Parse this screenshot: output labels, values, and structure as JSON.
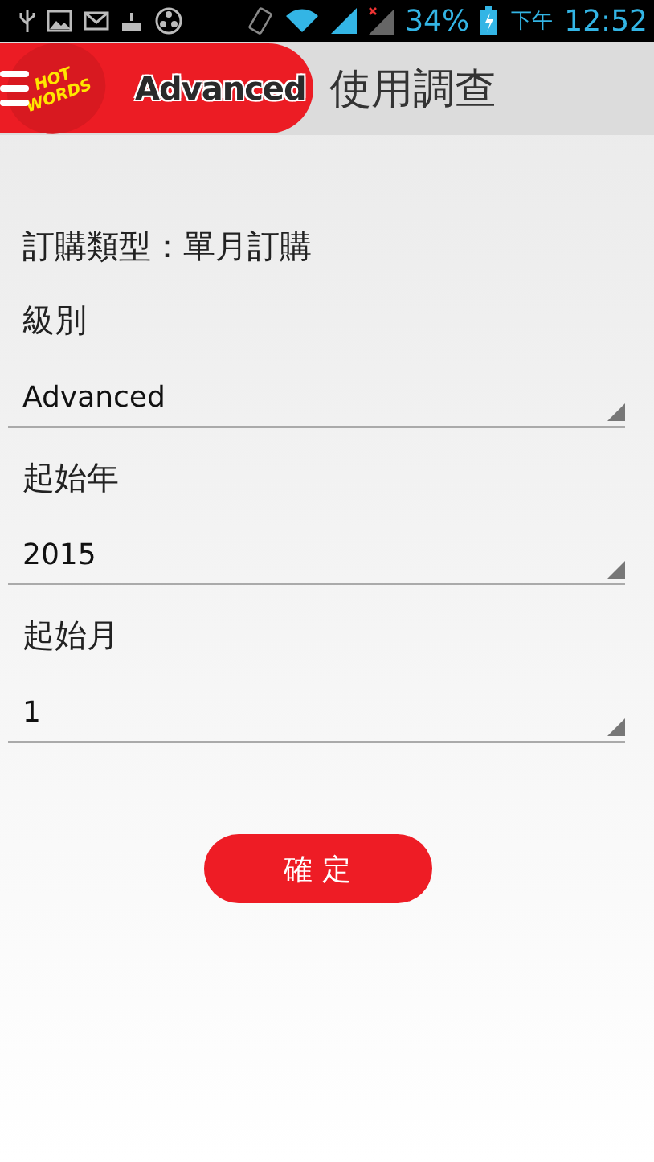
{
  "status_bar": {
    "battery": "34%",
    "period": "下午",
    "time": "12:52"
  },
  "header": {
    "logo_top": "HOT",
    "logo_bottom": "WORDS",
    "brand": "Advanced",
    "title": "使用調查"
  },
  "form": {
    "subscription_type": "訂購類型：單月訂購",
    "fields": [
      {
        "label": "級別",
        "value": "Advanced"
      },
      {
        "label": "起始年",
        "value": "2015"
      },
      {
        "label": "起始月",
        "value": "1"
      }
    ]
  },
  "confirm_button": "確 定"
}
